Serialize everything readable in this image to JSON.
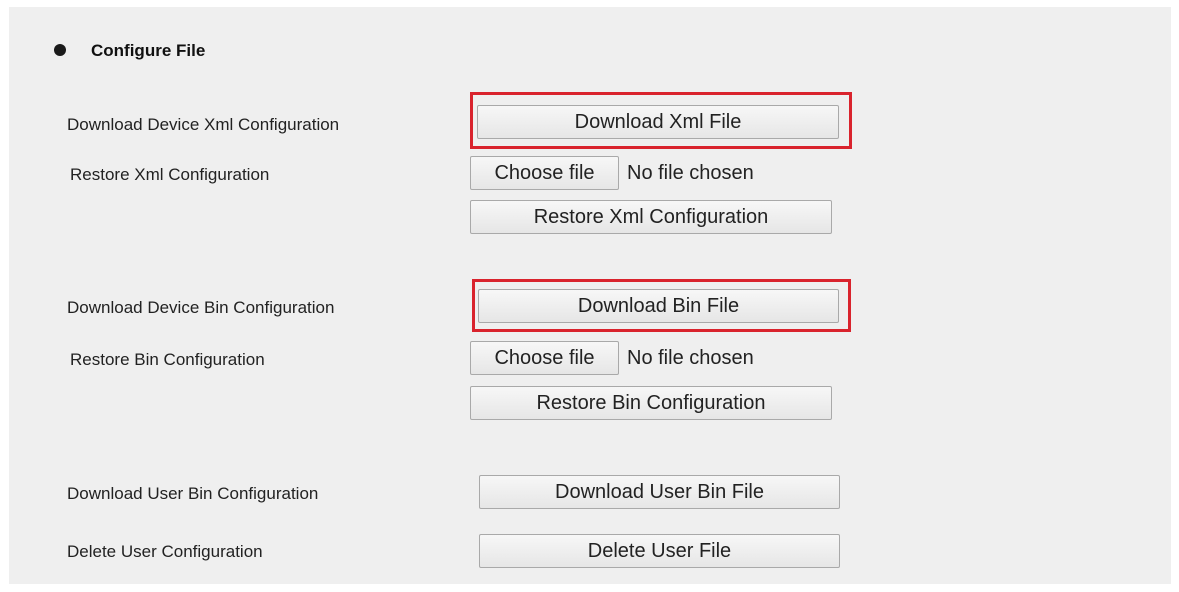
{
  "section": {
    "title": "Configure File"
  },
  "rows": {
    "download_xml": {
      "label": "Download Device Xml Configuration",
      "button": "Download Xml File"
    },
    "restore_xml": {
      "label": "Restore Xml Configuration",
      "choose_button": "Choose file",
      "file_status": "No file chosen",
      "restore_button": "Restore Xml Configuration"
    },
    "download_bin": {
      "label": "Download Device Bin Configuration",
      "button": "Download Bin File"
    },
    "restore_bin": {
      "label": "Restore Bin Configuration",
      "choose_button": "Choose file",
      "file_status": "No file chosen",
      "restore_button": "Restore Bin Configuration"
    },
    "download_user_bin": {
      "label": "Download User Bin Configuration",
      "button": "Download User Bin File"
    },
    "delete_user": {
      "label": "Delete User Configuration",
      "button": "Delete User File"
    }
  },
  "colors": {
    "highlight": "#d9232d",
    "panel_background": "#efefef"
  }
}
